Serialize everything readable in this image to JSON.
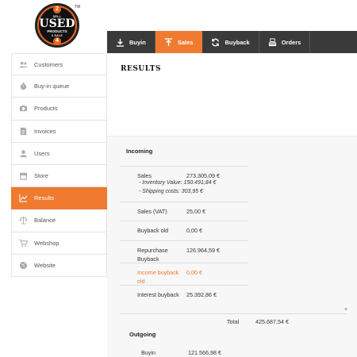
{
  "logo": {
    "top_number": "2",
    "top_word": "SELL",
    "big_word": "USED",
    "sub_word": "PRODUCTS",
    "bottom_word": "4 SALE",
    "bottom_number": "4",
    "trademark": "TM"
  },
  "topnav": {
    "tabs": [
      {
        "label": "Buyin",
        "icon": "download-icon",
        "active": false
      },
      {
        "label": "Sales",
        "icon": "upload-icon",
        "active": true
      },
      {
        "label": "Buyback",
        "icon": "refresh-icon",
        "active": false
      },
      {
        "label": "Orders",
        "icon": "register-icon",
        "active": false
      }
    ]
  },
  "sidebar": {
    "items": [
      {
        "label": "Customers",
        "icon": "users-icon"
      },
      {
        "label": "Buy-in queue",
        "icon": "stopwatch-icon"
      },
      {
        "label": "Products",
        "icon": "camera-icon"
      },
      {
        "label": "Invoices",
        "icon": "document-icon"
      },
      {
        "label": "Users",
        "icon": "user-icon"
      },
      {
        "label": "Store",
        "icon": "store-icon"
      },
      {
        "label": "Results",
        "icon": "chart-icon",
        "active": true
      },
      {
        "label": "Balance",
        "icon": "scale-icon"
      },
      {
        "label": "Webshop",
        "icon": "cart-icon"
      },
      {
        "label": "Website",
        "icon": "globe-icon"
      }
    ]
  },
  "results": {
    "title": "RESULTS",
    "incoming_title": "Incoming",
    "rows": {
      "sales": {
        "label": "Sales",
        "value": "273.305,09 €",
        "inventory": "- Inventory Value:  150.491,84 €",
        "shipping": "- Shipping costs: 303,95 €"
      },
      "sales_vat": {
        "label": "Sales (VAT)",
        "value": "25,00 €"
      },
      "buyback_old": {
        "label": "Buyback old",
        "value": "0,00 €"
      },
      "repurchase_buyback": {
        "label": "Repurchase Buyback",
        "value": "126.964,59 €"
      },
      "income_buyback_old": {
        "label": "Income buyback old",
        "value": "0,00 €"
      },
      "interest_buyback": {
        "label": "Interest buyback",
        "value": "25.392,86 €"
      }
    },
    "plus": "+",
    "total_label": "Total",
    "total_value": "425.687,54 €",
    "outgoing_title": "Outgoing",
    "outgoing": {
      "buyin_label": "Buyin",
      "buyin_value": "121.566,98 €"
    }
  },
  "colors": {
    "accent": "#f07a30",
    "nav_bg": "#3a3a3a",
    "content_bg": "#f7f7f7"
  }
}
